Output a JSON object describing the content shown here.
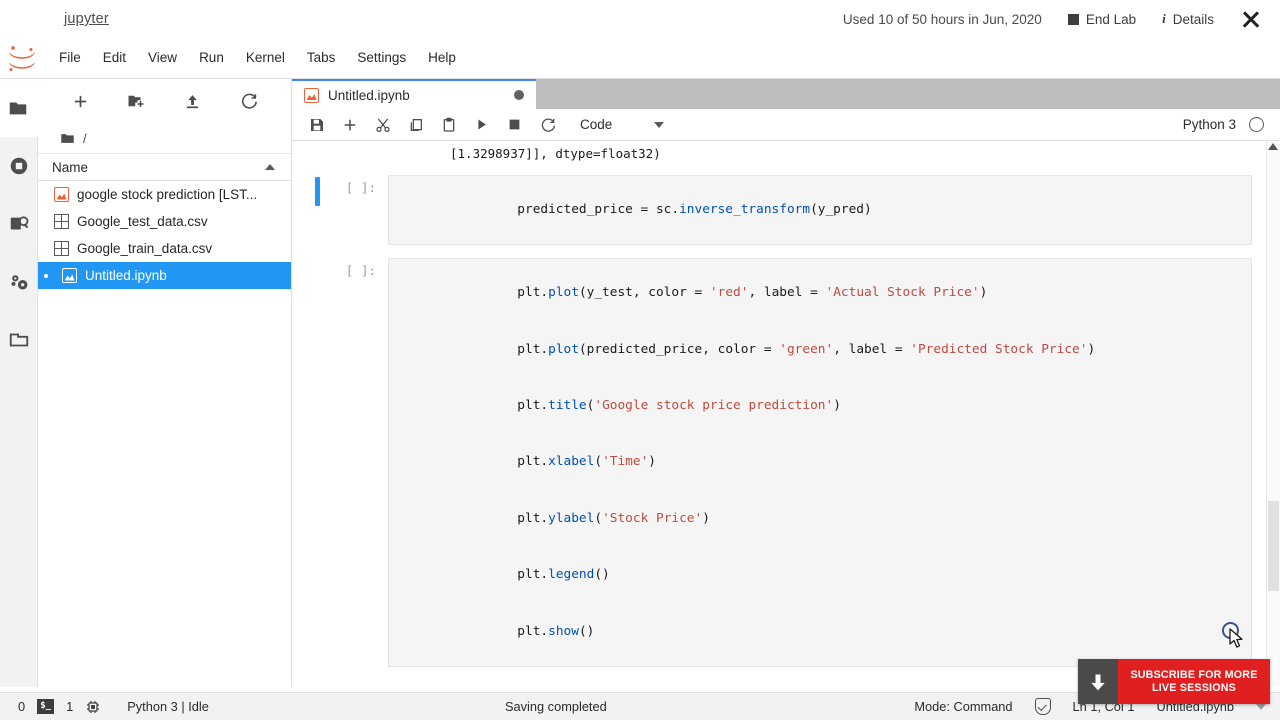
{
  "labbar": {
    "brand": "jupyter",
    "hours_used": "Used 10 of 50 hours in Jun, 2020",
    "end_lab_label": "End Lab",
    "details_label": "Details",
    "info_glyph": "i"
  },
  "menubar": {
    "items": [
      {
        "label": "File"
      },
      {
        "label": "Edit"
      },
      {
        "label": "View"
      },
      {
        "label": "Run"
      },
      {
        "label": "Kernel"
      },
      {
        "label": "Tabs"
      },
      {
        "label": "Settings"
      },
      {
        "label": "Help"
      }
    ]
  },
  "activitybar": {
    "items": [
      {
        "name": "file-browser",
        "icon": "folder-icon",
        "active": true
      },
      {
        "name": "running-terminals",
        "icon": "stop-circle-icon",
        "active": false
      },
      {
        "name": "commands",
        "icon": "command-palette-icon",
        "active": false
      },
      {
        "name": "property-inspector",
        "icon": "gears-icon",
        "active": false
      },
      {
        "name": "open-tabs",
        "icon": "tab-icon",
        "active": false
      }
    ]
  },
  "filebrowser": {
    "toolbar": [
      {
        "name": "new-launcher-button",
        "icon": "plus-icon"
      },
      {
        "name": "new-folder-button",
        "icon": "new-folder-icon"
      },
      {
        "name": "upload-button",
        "icon": "upload-icon"
      },
      {
        "name": "refresh-button",
        "icon": "refresh-icon"
      }
    ],
    "breadcrumb": "/",
    "column_header": "Name",
    "items": [
      {
        "label": "google stock prediction [LST...",
        "icon": "notebook-icon",
        "selected": false
      },
      {
        "label": "Google_test_data.csv",
        "icon": "csv-icon",
        "selected": false
      },
      {
        "label": "Google_train_data.csv",
        "icon": "csv-icon",
        "selected": false
      },
      {
        "label": "Untitled.ipynb",
        "icon": "notebook-icon",
        "selected": true
      }
    ]
  },
  "notebook": {
    "tab_title": "Untitled.ipynb",
    "toolbar": [
      {
        "name": "save-button",
        "icon": "save-icon"
      },
      {
        "name": "insert-cell-button",
        "icon": "plus-icon"
      },
      {
        "name": "cut-button",
        "icon": "scissors-icon"
      },
      {
        "name": "copy-button",
        "icon": "copy-icon"
      },
      {
        "name": "paste-button",
        "icon": "clipboard-icon"
      },
      {
        "name": "run-button",
        "icon": "play-icon"
      },
      {
        "name": "interrupt-button",
        "icon": "stop-icon"
      },
      {
        "name": "restart-button",
        "icon": "restart-icon"
      }
    ],
    "cell_type": "Code",
    "kernel_name": "Python 3",
    "output_tail": "[1.3298937]], dtype=float32)",
    "cells": [
      {
        "prompt": "[ ]:",
        "active": true,
        "lines": [
          [
            {
              "t": "predicted_price = sc.",
              "c": "k-punct"
            },
            {
              "t": "inverse_transform",
              "c": "k-attr"
            },
            {
              "t": "(y_pred)",
              "c": "k-punct"
            }
          ]
        ]
      },
      {
        "prompt": "[ ]:",
        "active": false,
        "lines": [
          [
            {
              "t": "plt.",
              "c": "k-punct"
            },
            {
              "t": "plot",
              "c": "k-attr"
            },
            {
              "t": "(y_test, color = ",
              "c": "k-punct"
            },
            {
              "t": "'red'",
              "c": "k-str"
            },
            {
              "t": ", label = ",
              "c": "k-punct"
            },
            {
              "t": "'Actual Stock Price'",
              "c": "k-str"
            },
            {
              "t": ")",
              "c": "k-punct"
            }
          ],
          [
            {
              "t": "plt.",
              "c": "k-punct"
            },
            {
              "t": "plot",
              "c": "k-attr"
            },
            {
              "t": "(predicted_price, color = ",
              "c": "k-punct"
            },
            {
              "t": "'green'",
              "c": "k-str"
            },
            {
              "t": ", label = ",
              "c": "k-punct"
            },
            {
              "t": "'Predicted Stock Price'",
              "c": "k-str"
            },
            {
              "t": ")",
              "c": "k-punct"
            }
          ],
          [
            {
              "t": "plt.",
              "c": "k-punct"
            },
            {
              "t": "title",
              "c": "k-attr"
            },
            {
              "t": "(",
              "c": "k-punct"
            },
            {
              "t": "'Google stock price prediction'",
              "c": "k-str"
            },
            {
              "t": ")",
              "c": "k-punct"
            }
          ],
          [
            {
              "t": "plt.",
              "c": "k-punct"
            },
            {
              "t": "xlabel",
              "c": "k-attr"
            },
            {
              "t": "(",
              "c": "k-punct"
            },
            {
              "t": "'Time'",
              "c": "k-str"
            },
            {
              "t": ")",
              "c": "k-punct"
            }
          ],
          [
            {
              "t": "plt.",
              "c": "k-punct"
            },
            {
              "t": "ylabel",
              "c": "k-attr"
            },
            {
              "t": "(",
              "c": "k-punct"
            },
            {
              "t": "'Stock Price'",
              "c": "k-str"
            },
            {
              "t": ")",
              "c": "k-punct"
            }
          ],
          [
            {
              "t": "plt.",
              "c": "k-punct"
            },
            {
              "t": "legend",
              "c": "k-attr"
            },
            {
              "t": "()",
              "c": "k-punct"
            }
          ],
          [
            {
              "t": "plt.",
              "c": "k-punct"
            },
            {
              "t": "show",
              "c": "k-attr"
            },
            {
              "t": "()",
              "c": "k-punct"
            }
          ]
        ]
      }
    ]
  },
  "statusbar": {
    "terminal_count": "0",
    "terminal_glyph": "$_",
    "kernel_count": "1",
    "kernel_status": "Python 3 | Idle",
    "save_status": "Saving completed",
    "mode": "Mode: Command",
    "cursor_position": "Ln 1, Col 1",
    "filename": "Untitled.ipynb"
  },
  "subscribe_banner": {
    "line1": "SUBSCRIBE FOR MORE",
    "line2": "LIVE SESSIONS"
  },
  "colors": {
    "accent_blue": "#2196f3",
    "tab_blue": "#4285f4",
    "jupyter_orange": "#e8633a",
    "banner_red": "#e02020",
    "string_red": "#bf4a3f",
    "attr_blue": "#0050b3"
  }
}
